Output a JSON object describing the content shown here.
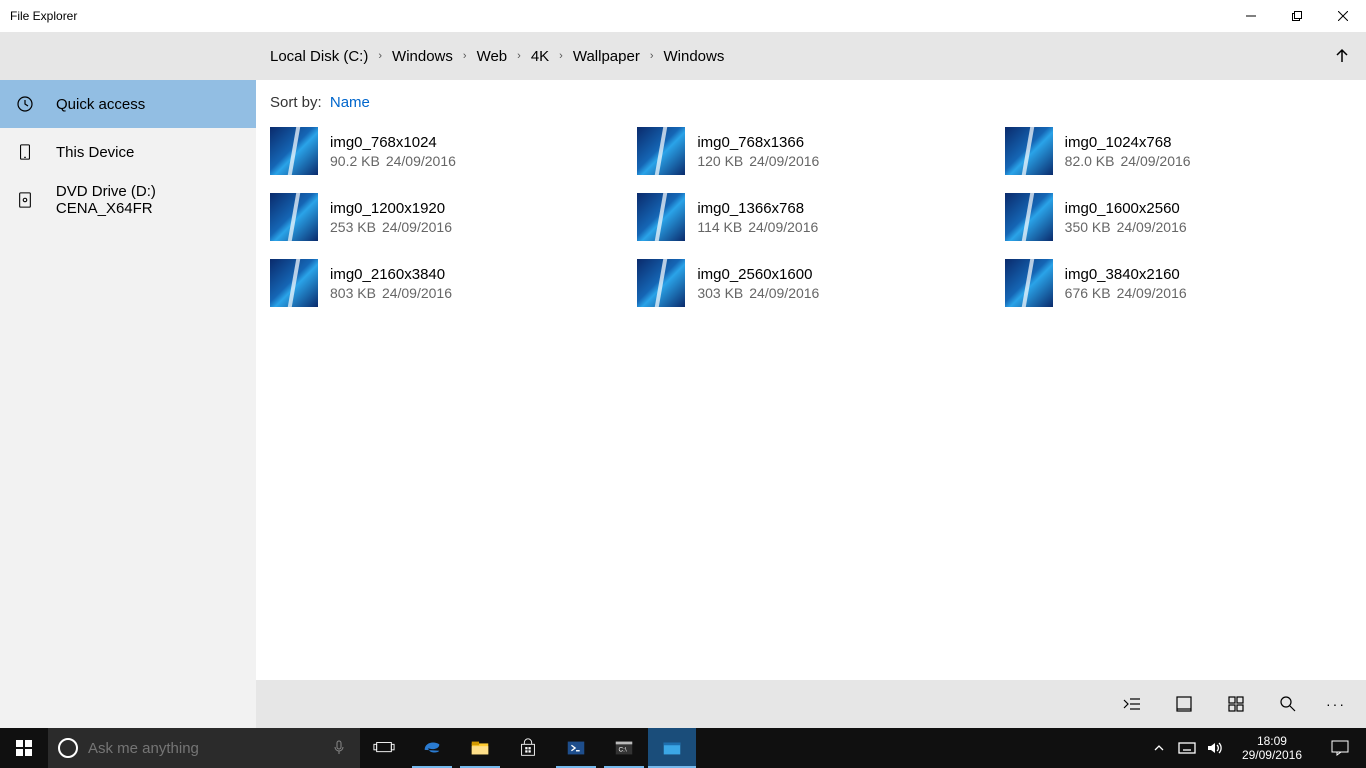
{
  "window": {
    "title": "File Explorer"
  },
  "breadcrumb": [
    "Local Disk (C:)",
    "Windows",
    "Web",
    "4K",
    "Wallpaper",
    "Windows"
  ],
  "sidebar": {
    "items": [
      {
        "label": "Quick access",
        "active": true
      },
      {
        "label": "This Device",
        "active": false
      },
      {
        "label": "DVD Drive (D:) CENA_X64FR",
        "active": false
      }
    ]
  },
  "sort": {
    "label": "Sort by:",
    "value": "Name"
  },
  "files": [
    {
      "name": "img0_768x1024",
      "size": "90.2 KB",
      "date": "24/09/2016"
    },
    {
      "name": "img0_768x1366",
      "size": "120 KB",
      "date": "24/09/2016"
    },
    {
      "name": "img0_1024x768",
      "size": "82.0 KB",
      "date": "24/09/2016"
    },
    {
      "name": "img0_1200x1920",
      "size": "253 KB",
      "date": "24/09/2016"
    },
    {
      "name": "img0_1366x768",
      "size": "114 KB",
      "date": "24/09/2016"
    },
    {
      "name": "img0_1600x2560",
      "size": "350 KB",
      "date": "24/09/2016"
    },
    {
      "name": "img0_2160x3840",
      "size": "803 KB",
      "date": "24/09/2016"
    },
    {
      "name": "img0_2560x1600",
      "size": "303 KB",
      "date": "24/09/2016"
    },
    {
      "name": "img0_3840x2160",
      "size": "676 KB",
      "date": "24/09/2016"
    }
  ],
  "taskbar": {
    "search_placeholder": "Ask me anything",
    "time": "18:09",
    "date": "29/09/2016"
  }
}
